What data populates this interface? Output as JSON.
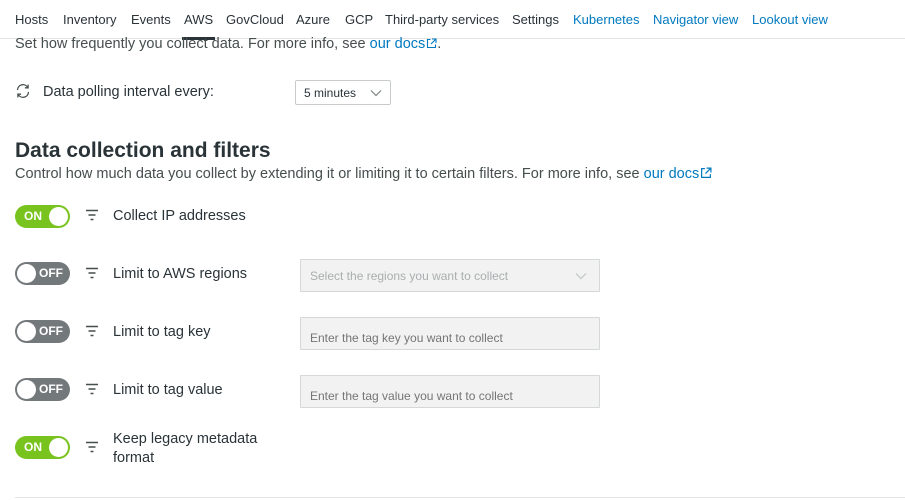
{
  "nav": {
    "tabs": [
      {
        "label": "Hosts"
      },
      {
        "label": "Inventory"
      },
      {
        "label": "Events"
      },
      {
        "label": "AWS"
      },
      {
        "label": "GovCloud"
      },
      {
        "label": "Azure"
      },
      {
        "label": "GCP"
      },
      {
        "label": "Third-party services"
      },
      {
        "label": "Settings"
      },
      {
        "label": "Kubernetes"
      },
      {
        "label": "Navigator view"
      },
      {
        "label": "Lookout view"
      }
    ],
    "active_tab": "AWS"
  },
  "polling": {
    "intro_text": "Set how frequently you collect data. For more info, see ",
    "docs_link": "our docs",
    "intro_suffix": ".",
    "label": "Data polling interval every:",
    "interval_value": "5 minutes",
    "icon": "sync-icon"
  },
  "data_collection": {
    "title": "Data collection and filters",
    "description": "Control how much data you collect by extending it or limiting it to certain filters. For more info, see ",
    "docs_link": "our docs",
    "filters": [
      {
        "label": "Collect IP addresses",
        "toggle": "ON",
        "enabled": true
      },
      {
        "label": "Limit to AWS regions",
        "toggle": "OFF",
        "enabled": false,
        "placeholder": "Select the regions you want to collect"
      },
      {
        "label": "Limit to tag key",
        "toggle": "OFF",
        "enabled": false,
        "placeholder": "Enter the tag key you want to collect"
      },
      {
        "label": "Limit to tag value",
        "toggle": "OFF",
        "enabled": false,
        "placeholder": "Enter the tag value you want to collect"
      },
      {
        "label": "Keep legacy metadata format",
        "toggle": "ON",
        "enabled": true
      }
    ]
  },
  "colors": {
    "toggle_on": "#78c31e",
    "toggle_off": "#73787a",
    "link": "#0079bf",
    "text": "#293338"
  }
}
